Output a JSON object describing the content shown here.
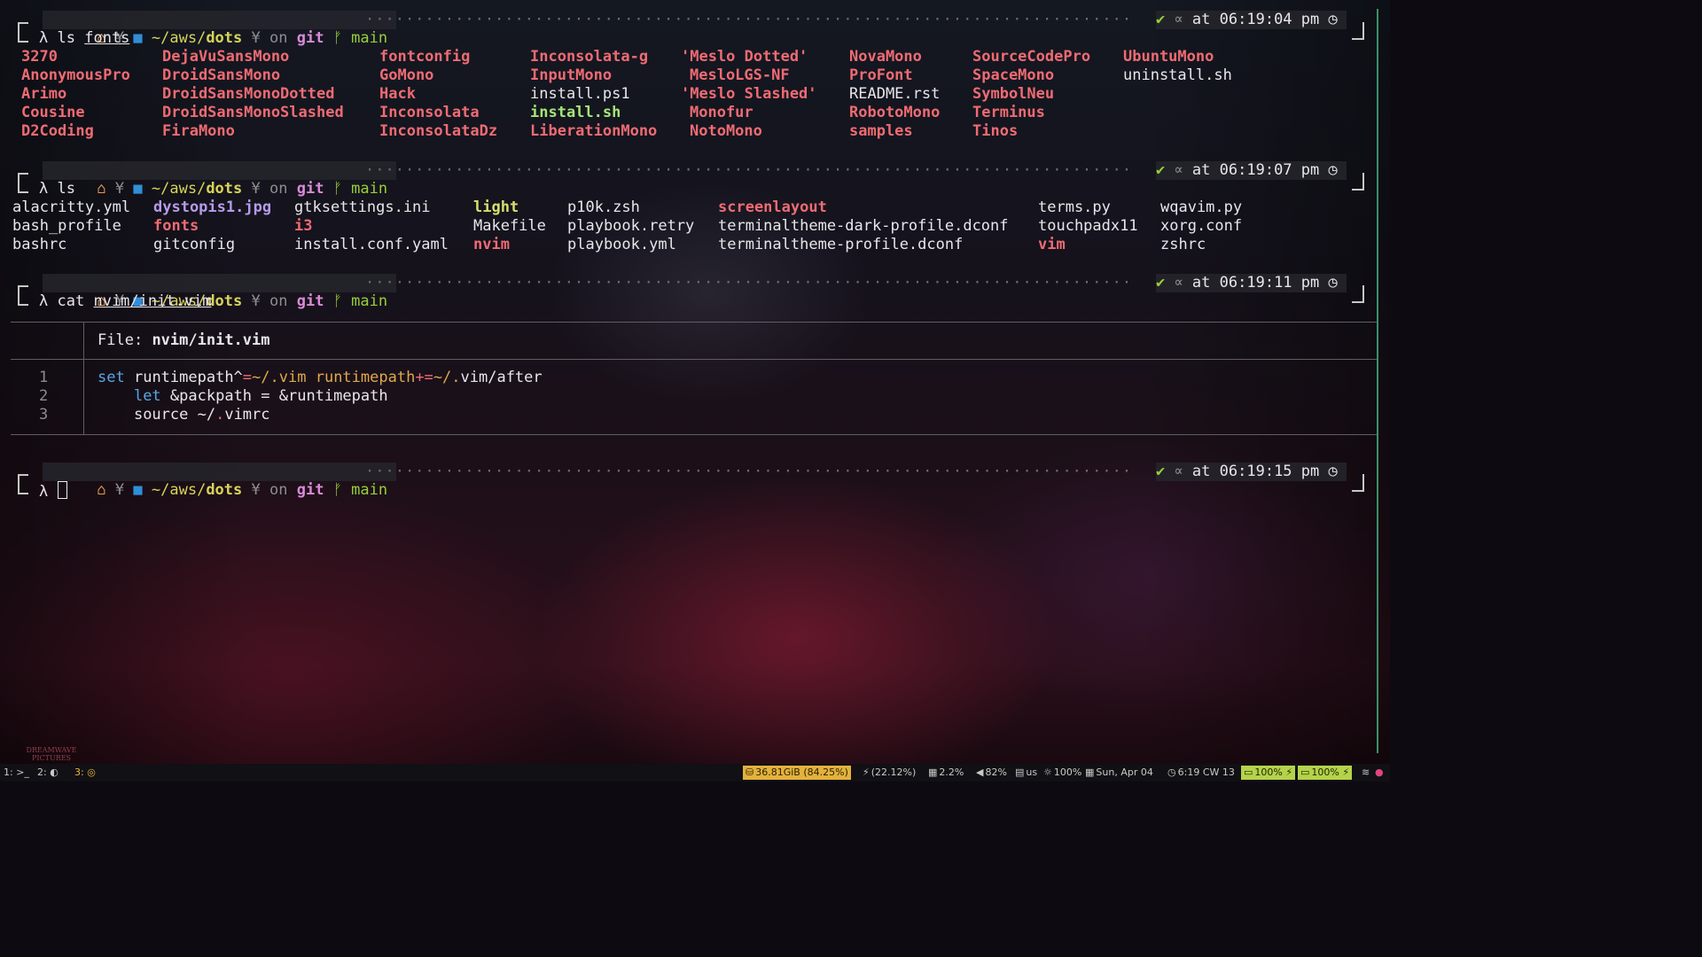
{
  "prompt": {
    "path_prefix": "~/aws/",
    "path_dir": "dots",
    "on": "on",
    "git": "git",
    "branch_icon": "branch-icon",
    "branch": "main",
    "check": "✔",
    "at": "at",
    "symbol": "λ"
  },
  "blocks": [
    {
      "time": "06:19:04 pm",
      "command": "ls",
      "arg": "fonts",
      "listing": {
        "columns": [
          [
            "3270",
            "AnonymousPro",
            "Arimo",
            "Cousine",
            "D2Coding"
          ],
          [
            "DejaVuSansMono",
            "DroidSansMono",
            "DroidSansMonoDotted",
            "DroidSansMonoSlashed",
            "FiraMono"
          ],
          [
            "fontconfig",
            "GoMono",
            "Hack",
            "Inconsolata",
            "InconsolataDz"
          ],
          [
            "Inconsolata-g",
            "InputMono",
            "install.ps1",
            "install.sh",
            "LiberationMono"
          ],
          [
            "'Meslo Dotted'",
            "MesloLGS-NF",
            "'Meslo Slashed'",
            "Monofur",
            "NotoMono"
          ],
          [
            "NovaMono",
            "ProFont",
            "README.rst",
            "RobotoMono",
            "samples"
          ],
          [
            "SourceCodePro",
            "SpaceMono",
            "SymbolNeu",
            "Terminus",
            "Tinos"
          ],
          [
            "UbuntuMono",
            "uninstall.sh"
          ]
        ]
      }
    },
    {
      "time": "06:19:07 pm",
      "command": "ls",
      "arg": "",
      "listing": {
        "columns": [
          [
            "alacritty.yml",
            "bash_profile",
            "bashrc"
          ],
          [
            "dystopis1.jpg",
            "fonts",
            "gitconfig"
          ],
          [
            "gtksettings.ini",
            "i3",
            "install.conf.yaml"
          ],
          [
            "light",
            "Makefile",
            "nvim"
          ],
          [
            "p10k.zsh",
            "playbook.retry",
            "playbook.yml"
          ],
          [
            "screenlayout",
            "terminaltheme-dark-profile.dconf",
            "terminaltheme-profile.dconf"
          ],
          [
            "terms.py",
            "touchpadx11",
            "vim"
          ],
          [
            "wqavim.py",
            "xorg.conf",
            "zshrc"
          ]
        ]
      }
    },
    {
      "time": "06:19:11 pm",
      "command": "cat",
      "arg": "nvim/init.vim",
      "bat": {
        "file_label": "File:",
        "file_name": "nvim/init.vim",
        "lines": [
          {
            "n": "1",
            "text": "set runtimepath^=~/.vim runtimepath+=~/.vim/after"
          },
          {
            "n": "2",
            "text": "    let &packpath = &runtimepath"
          },
          {
            "n": "3",
            "text": "    source ~/.vimrc"
          }
        ]
      }
    },
    {
      "time": "06:19:15 pm",
      "command": "",
      "arg": ""
    }
  ],
  "statusbar": {
    "workspaces": [
      {
        "num": "1:",
        "icon": "terminal-icon",
        "glyph": ">_"
      },
      {
        "num": "2:",
        "icon": "firefox-icon",
        "glyph": "◐"
      },
      {
        "num": "3:",
        "icon": "chrome-icon",
        "glyph": "◎"
      }
    ],
    "disk": "36.81GiB (84.25%)",
    "cpu": "(22.12%)",
    "load": "2.2%",
    "volume": "82%",
    "keyboard": "us",
    "brightness": "100%",
    "date": "Sun, Apr 04",
    "time": "6:19",
    "week": "CW 13",
    "battery1": "100%",
    "battery2": "100%",
    "colors": {
      "disk": "#e3b23c",
      "battery": "#b5d34a",
      "accent": "#3c8f6a"
    }
  },
  "wallpaper_logo": "DREAMWAVE PICTURES"
}
